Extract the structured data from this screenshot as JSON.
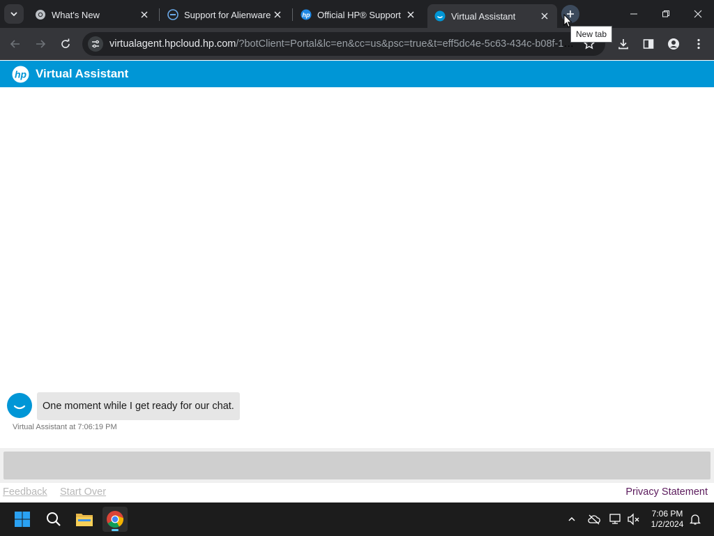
{
  "browser": {
    "tabs": [
      {
        "title": "What's New",
        "icon": "chrome-icon",
        "active": false
      },
      {
        "title": "Support for Alienware",
        "icon": "dell-icon",
        "active": false
      },
      {
        "title": "Official HP® Support",
        "icon": "hp-icon",
        "active": false
      },
      {
        "title": "Virtual Assistant",
        "icon": "virtual-assistant-icon",
        "active": true
      }
    ],
    "new_tab_tooltip": "New tab",
    "url_host": "virtualagent.hpcloud.hp.com",
    "url_rest": "/?botClient=Portal&lc=en&cc=us&psc=true&t=eff5dc4e-5c63-434c-b08f-187..."
  },
  "header": {
    "title": "Virtual Assistant",
    "brand_color": "#0096d6"
  },
  "chat": {
    "messages": [
      {
        "text": "One moment while I get ready for our chat.",
        "meta": "Virtual Assistant at 7:06:19 PM"
      }
    ]
  },
  "footer": {
    "feedback": "Feedback",
    "start_over": "Start Over",
    "privacy": "Privacy Statement"
  },
  "taskbar": {
    "time": "7:06 PM",
    "date": "1/2/2024"
  }
}
